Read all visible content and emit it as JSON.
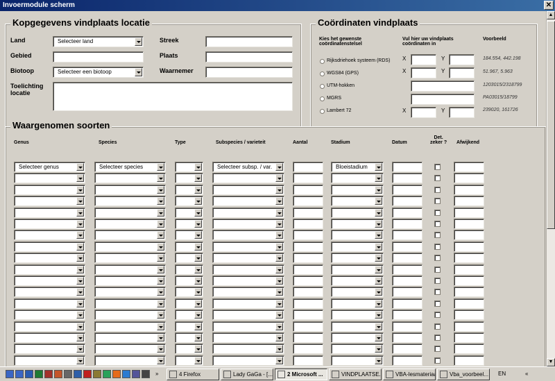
{
  "window": {
    "title": "Invoermodule scherm"
  },
  "location": {
    "title": "Kopgegevens vindplaats locatie",
    "land_label": "Land",
    "land_value": "Selecteer land",
    "streek_label": "Streek",
    "gebied_label": "Gebied",
    "plaats_label": "Plaats",
    "biotoop_label": "Biotoop",
    "biotoop_value": "Selecteer een biotoop",
    "waarnemer_label": "Waarnemer",
    "toelichting_label_1": "Toelichting",
    "toelichting_label_2": "locatie"
  },
  "coords": {
    "title": "Coördinaten vindplaats",
    "header_system_1": "Kies het gewenste",
    "header_system_2": "coördinatenstelsel",
    "header_input_1": "Vul hier uw vindplaats",
    "header_input_2": "coördinaten in",
    "header_example": "Voorbeeld",
    "x_label": "X",
    "y_label": "Y",
    "systems": [
      {
        "name": "Rijksdriehoek systeem (RDS)",
        "example": "184.554, 442.198"
      },
      {
        "name": "WGS84 (GPS)",
        "example": "51.967, 5.963"
      },
      {
        "name": "UTM-hokken",
        "example": "1203015/2318799"
      },
      {
        "name": "MGRS",
        "example": "PA03015/18799"
      },
      {
        "name": "Lambert 72",
        "example": "239020, 161726"
      }
    ]
  },
  "species": {
    "title": "Waargenomen soorten",
    "headers": {
      "genus": "Genus",
      "species": "Species",
      "type": "Type",
      "subspecies": "Subspecies / varieteit",
      "aantal": "Aantal",
      "stadium": "Stadium",
      "datum": "Datum",
      "det_1": "Det.",
      "det_2": "zeker ?",
      "afwijkend": "Afwijkend"
    },
    "first_row": {
      "genus": "Selecteer genus",
      "species": "Selecteer species",
      "subspecies": "Selecteer subsp. / var.",
      "stadium": "Bloeistadium"
    }
  },
  "taskbar": {
    "tasks": [
      {
        "label": "4 Firefox",
        "active": false
      },
      {
        "label": "Lady GaGa - [...",
        "active": false
      },
      {
        "label": "2 Microsoft ...",
        "active": true
      },
      {
        "label": "VINDPLAATSE...",
        "active": false
      },
      {
        "label": "VBA-lesmateriaal",
        "active": false
      },
      {
        "label": "Vba_voorbeel...",
        "active": false
      }
    ],
    "language": "EN",
    "chevron": "»",
    "tray_chevron": "«"
  },
  "icons": {
    "close": "close-icon",
    "dropdown": "chevron-down-icon",
    "quicklaunch": [
      "desktop-icon",
      "explorer-icon",
      "word-icon",
      "excel-icon",
      "access-icon",
      "powerpoint-icon",
      "graduation-icon",
      "outlook-icon",
      "acrobat-icon",
      "zip-icon",
      "sync-icon",
      "firefox-icon",
      "ie-icon",
      "ftp-icon",
      "calculator-icon"
    ]
  },
  "colors": {
    "titlebar_start": "#0a246a",
    "titlebar_end": "#3a6ea5",
    "window_bg": "#d4d0c8",
    "quicklaunch": [
      "#3b66c4",
      "#3b66c4",
      "#2b5bb0",
      "#1f7a34",
      "#a3312b",
      "#c4552a",
      "#666666",
      "#2e5fa8",
      "#c0201d",
      "#8a7a34",
      "#2aa15a",
      "#e56b1c",
      "#2b7bd1",
      "#555599",
      "#444444"
    ]
  }
}
